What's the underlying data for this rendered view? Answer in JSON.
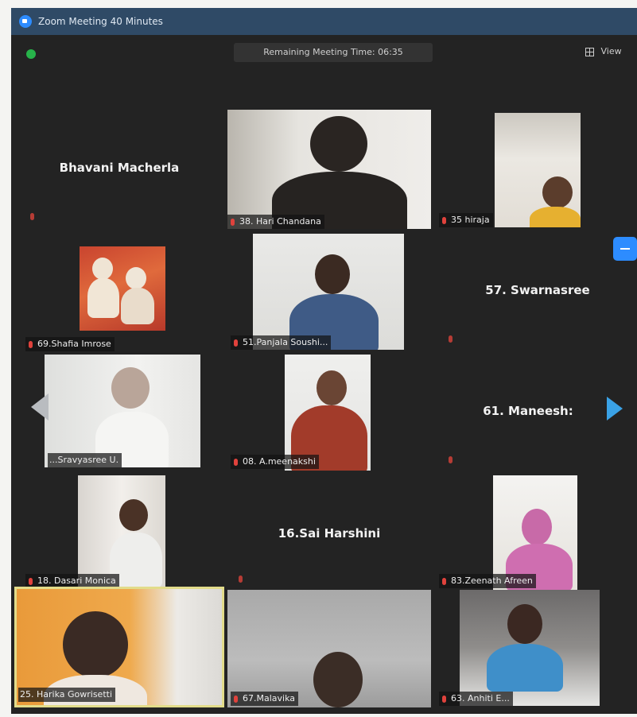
{
  "window": {
    "title": "Zoom Meeting 40 Minutes"
  },
  "topbar": {
    "timer": "Remaining Meeting Time: 06:35",
    "view_label": "View"
  },
  "participants": {
    "bhavani": "Bhavani Macherla",
    "hari": "38. Hari Chandana",
    "hiraja": "35 hiraja",
    "shafia": "69.Shafia Imrose",
    "panjala": "51.Panjala Soushi...",
    "swarnasree": "57. Swarnasree",
    "sravyasree": "...Sravyasree U.",
    "meenakshi": "08. A.meenakshi",
    "maneesh": "61. Maneesh:",
    "dasari": "18. Dasari Monica",
    "saiharshini": "16.Sai Harshini",
    "zeenath": "83.Zeenath Afreen",
    "harika": "25. Harika Gowrisetti",
    "malavika": "67.Malavika",
    "anhiti": "63. Anhiti E..."
  },
  "colors": {
    "titlebar": "#2f4a66",
    "background": "#232323",
    "active_speaker_border": "#e2dc8a",
    "muted_mic": "#e0423c",
    "nav_arrow": "#3aa2e6"
  },
  "icons": {
    "app": "zoom-logo-icon",
    "security": "shield-icon",
    "view": "grid-view-icon",
    "mic": "mic-muted-icon"
  }
}
